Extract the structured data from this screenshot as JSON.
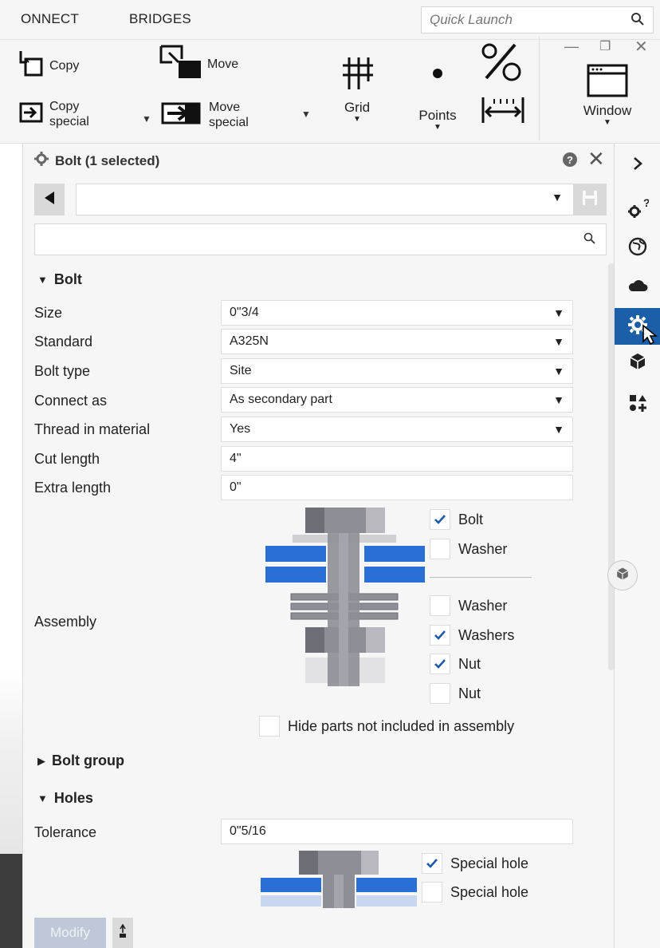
{
  "ribbon": {
    "tabs": [
      "ONNECT",
      "BRIDGES"
    ],
    "quick_launch_placeholder": "Quick Launch",
    "copy_label": "Copy",
    "copy_special_label_1": "Copy",
    "copy_special_label_2": "special",
    "move_label": "Move",
    "move_special_label_1": "Move",
    "move_special_label_2": "special",
    "grid_label": "Grid",
    "points_label": "Points",
    "window_label": "Window"
  },
  "panel": {
    "title": "Bolt (1 selected)",
    "preset_value": "",
    "search_value": "",
    "sections": {
      "bolt": "Bolt",
      "bolt_group": "Bolt group",
      "holes": "Holes"
    },
    "bolt_fields": [
      {
        "label": "Size",
        "value": "0\"3/4",
        "dropdown": true
      },
      {
        "label": "Standard",
        "value": "A325N",
        "dropdown": true
      },
      {
        "label": "Bolt type",
        "value": "Site",
        "dropdown": true
      },
      {
        "label": "Connect as",
        "value": "As secondary part",
        "dropdown": true
      },
      {
        "label": "Thread in material",
        "value": "Yes",
        "dropdown": true
      },
      {
        "label": "Cut length",
        "value": "4\"",
        "dropdown": false
      },
      {
        "label": "Extra length",
        "value": "0\"",
        "dropdown": false
      }
    ],
    "assembly_label": "Assembly",
    "assembly_checks": [
      {
        "label": "Bolt",
        "checked": true
      },
      {
        "label": "Washer",
        "checked": false
      },
      {
        "label": "Washer",
        "checked": false
      },
      {
        "label": "Washers",
        "checked": true
      },
      {
        "label": "Nut",
        "checked": true
      },
      {
        "label": "Nut",
        "checked": false
      }
    ],
    "hide_parts_label": "Hide parts not included in assembly",
    "hide_parts_checked": false,
    "tolerance_label": "Tolerance",
    "tolerance_value": "0\"5/16",
    "hole_checks": [
      {
        "label": "Special hole",
        "checked": true
      },
      {
        "label": "Special hole",
        "checked": false
      }
    ],
    "modify_label": "Modify"
  },
  "colors": {
    "accent": "#1a5fa8",
    "plate_blue": "#2a6fd6",
    "check_blue": "#1e5aa8"
  }
}
